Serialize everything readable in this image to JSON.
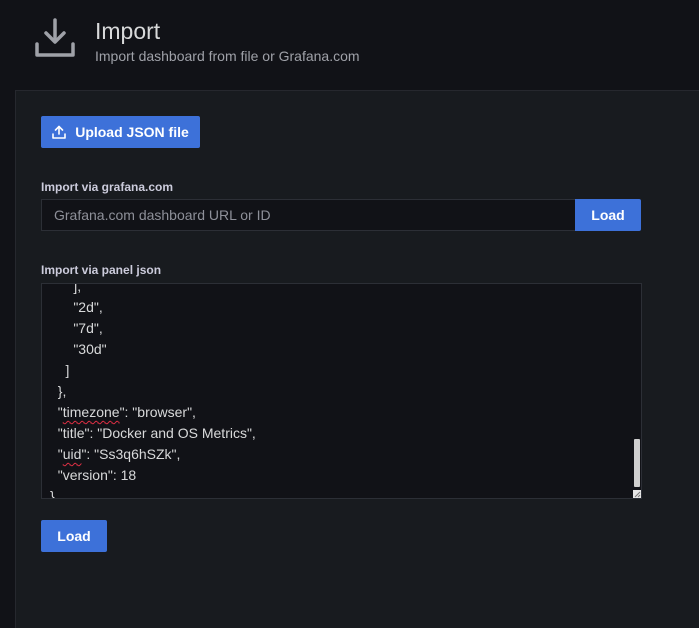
{
  "header": {
    "title": "Import",
    "subtitle": "Import dashboard from file or Grafana.com",
    "icon": "download-icon"
  },
  "upload": {
    "label": "Upload JSON file",
    "icon": "upload-icon"
  },
  "grafana_com": {
    "label": "Import via grafana.com",
    "placeholder": "Grafana.com dashboard URL or ID",
    "value": "",
    "load_label": "Load"
  },
  "panel_json": {
    "label": "Import via panel json",
    "lines": [
      "      ],",
      "      \"2d\",",
      "      \"7d\",",
      "      \"30d\"",
      "    ]",
      "  },",
      "  \"timezone\": \"browser\",",
      "  \"title\": \"Docker and OS Metrics\",",
      "  \"uid\": \"Ss3q6hSZk\",",
      "  \"version\": 18",
      "}"
    ]
  },
  "load_label": "Load",
  "colors": {
    "primary": "#3d71d9",
    "background": "#111217",
    "panel": "#181b1f"
  }
}
